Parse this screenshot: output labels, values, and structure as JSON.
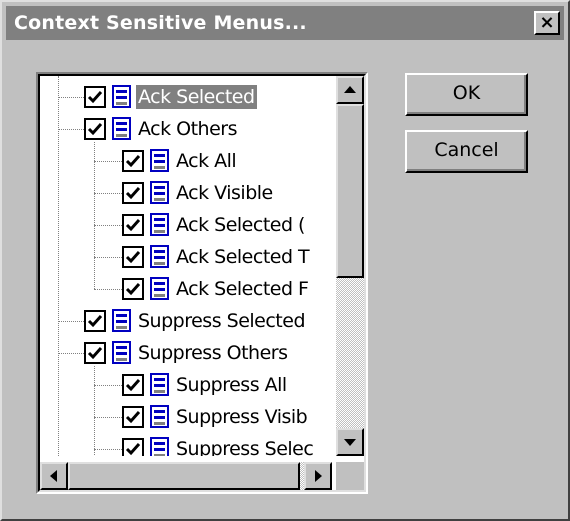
{
  "window": {
    "title": "Context Sensitive Menus...",
    "close_glyph": "×"
  },
  "tree": {
    "items": [
      {
        "label": "Ack Selected",
        "level": 0,
        "checked": true,
        "selected": true,
        "icon": "menu-item-icon"
      },
      {
        "label": "Ack Others",
        "level": 0,
        "checked": true,
        "selected": false,
        "icon": "menu-item-icon"
      },
      {
        "label": "Ack All",
        "level": 1,
        "checked": true,
        "selected": false,
        "icon": "menu-item-icon"
      },
      {
        "label": "Ack Visible",
        "level": 1,
        "checked": true,
        "selected": false,
        "icon": "menu-item-icon"
      },
      {
        "label": "Ack Selected (",
        "level": 1,
        "checked": true,
        "selected": false,
        "icon": "menu-item-icon"
      },
      {
        "label": "Ack Selected T",
        "level": 1,
        "checked": true,
        "selected": false,
        "icon": "menu-item-icon"
      },
      {
        "label": "Ack Selected F",
        "level": 1,
        "checked": true,
        "selected": false,
        "icon": "menu-item-icon"
      },
      {
        "label": "Suppress Selected",
        "level": 0,
        "checked": true,
        "selected": false,
        "icon": "menu-item-icon"
      },
      {
        "label": "Suppress Others",
        "level": 0,
        "checked": true,
        "selected": false,
        "icon": "menu-item-icon"
      },
      {
        "label": "Suppress All",
        "level": 1,
        "checked": true,
        "selected": false,
        "icon": "menu-item-icon"
      },
      {
        "label": "Suppress Visib",
        "level": 1,
        "checked": true,
        "selected": false,
        "icon": "menu-item-icon"
      },
      {
        "label": "Suppress Selec",
        "level": 1,
        "checked": true,
        "selected": false,
        "icon": "menu-item-icon"
      }
    ]
  },
  "buttons": {
    "ok_label": "OK",
    "cancel_label": "Cancel"
  },
  "colors": {
    "titlebar": "#808080",
    "selection": "#808080",
    "icon_blue": "#0000c0",
    "face": "#c0c0c0"
  }
}
